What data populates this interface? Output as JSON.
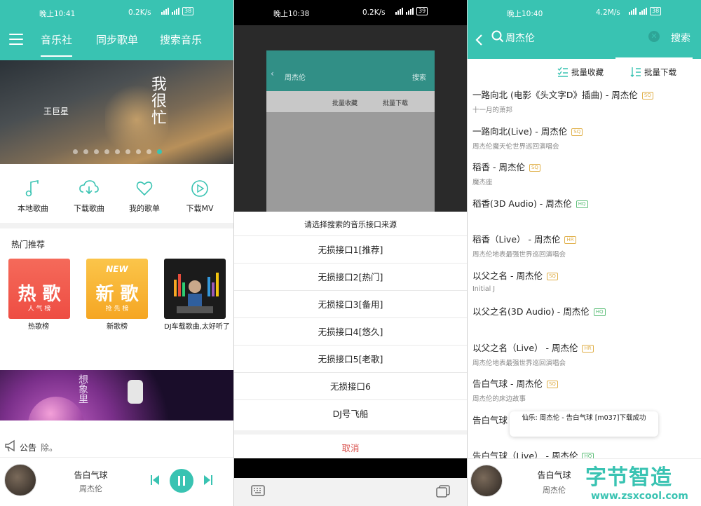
{
  "panel1": {
    "status": {
      "time": "晚上10:41",
      "speed": "0.2K/s",
      "battery": "38"
    },
    "tabs": [
      "音乐社",
      "同步歌单",
      "搜索音乐"
    ],
    "banner": {
      "artist": "王巨星",
      "title": "我很忙"
    },
    "quick_actions": [
      "本地歌曲",
      "下载歌曲",
      "我的歌单",
      "下载MV"
    ],
    "section_title": "热门推荐",
    "cards": [
      {
        "big": "热 歌",
        "small": "人 气 榜",
        "label": "热歌榜"
      },
      {
        "top": "NEW",
        "big": "新 歌",
        "small": "抢 先 榜",
        "label": "新歌榜"
      },
      {
        "label": "DJ车载歌曲,太好听了"
      }
    ],
    "promo": {
      "title": "想象里"
    },
    "notice": {
      "label": "公告",
      "text": "除。"
    },
    "player": {
      "title": "告白气球",
      "artist": "周杰伦"
    },
    "colors": {
      "accent": "#39c3b2"
    }
  },
  "panel2": {
    "status": {
      "time": "晚上10:38",
      "speed": "0.2K/s",
      "battery": "39"
    },
    "dim": {
      "query": "周杰伦",
      "search": "搜索",
      "batch_fav": "批量收藏",
      "batch_dl": "批量下载"
    },
    "sheet_title": "请选择搜索的音乐接口来源",
    "options": [
      "无损接口1[推荐]",
      "无损接口2[热门]",
      "无损接口3[备用]",
      "无损接口4[悠久]",
      "无损接口5[老歌]",
      "无损接口6",
      "DJ号飞船"
    ],
    "cancel": "取消"
  },
  "panel3": {
    "status": {
      "time": "晚上10:40",
      "speed": "4.2M/s",
      "battery": "38"
    },
    "query": "周杰伦",
    "search_btn": "搜索",
    "batch_fav": "批量收藏",
    "batch_dl": "批量下载",
    "songs": [
      {
        "title": "一路向北 (电影《头文字D》插曲) - 周杰伦",
        "q": "SQ",
        "sub": "十一月的萧邦"
      },
      {
        "title": "一路向北(Live) - 周杰伦",
        "q": "SQ",
        "sub": "周杰伦魔天伦世界巡回演唱会"
      },
      {
        "title": "稻香 - 周杰伦",
        "q": "SQ",
        "sub": "魔杰座"
      },
      {
        "title": "稻香(3D Audio) - 周杰伦",
        "q": "HQ",
        "sub": ""
      },
      {
        "title": "稻香（Live） - 周杰伦",
        "q": "HR",
        "sub": "周杰伦地表最强世界巡回演唱会"
      },
      {
        "title": "以父之名 - 周杰伦",
        "q": "SQ",
        "sub": "Initial J"
      },
      {
        "title": "以父之名(3D Audio) - 周杰伦",
        "q": "HQ",
        "sub": ""
      },
      {
        "title": "以父之名（Live） - 周杰伦",
        "q": "HR",
        "sub": "周杰伦地表最强世界巡回演唱会"
      },
      {
        "title": "告白气球 - 周杰伦",
        "q": "SQ",
        "sub": "周杰伦的床边故事"
      },
      {
        "title": "告白气球",
        "q": "",
        "sub": ""
      },
      {
        "title": "告白气球（Live） - 周杰伦",
        "q": "HQ",
        "sub": ""
      }
    ],
    "toast": "仙乐: 周杰伦 - 告白气球 [m037]下载成功",
    "player": {
      "title": "告白气球",
      "artist": "周杰伦"
    },
    "watermark": {
      "big": "字节智造",
      "url": "www.zsxcool.com"
    }
  }
}
